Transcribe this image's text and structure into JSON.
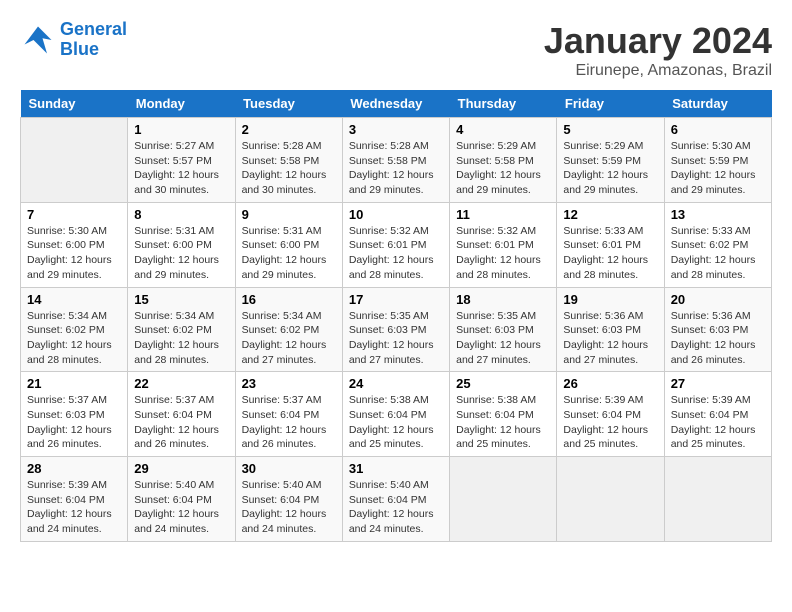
{
  "logo": {
    "line1": "General",
    "line2": "Blue"
  },
  "title": "January 2024",
  "location": "Eirunepe, Amazonas, Brazil",
  "days_header": [
    "Sunday",
    "Monday",
    "Tuesday",
    "Wednesday",
    "Thursday",
    "Friday",
    "Saturday"
  ],
  "weeks": [
    [
      {
        "day": "",
        "info": ""
      },
      {
        "day": "1",
        "info": "Sunrise: 5:27 AM\nSunset: 5:57 PM\nDaylight: 12 hours\nand 30 minutes."
      },
      {
        "day": "2",
        "info": "Sunrise: 5:28 AM\nSunset: 5:58 PM\nDaylight: 12 hours\nand 30 minutes."
      },
      {
        "day": "3",
        "info": "Sunrise: 5:28 AM\nSunset: 5:58 PM\nDaylight: 12 hours\nand 29 minutes."
      },
      {
        "day": "4",
        "info": "Sunrise: 5:29 AM\nSunset: 5:58 PM\nDaylight: 12 hours\nand 29 minutes."
      },
      {
        "day": "5",
        "info": "Sunrise: 5:29 AM\nSunset: 5:59 PM\nDaylight: 12 hours\nand 29 minutes."
      },
      {
        "day": "6",
        "info": "Sunrise: 5:30 AM\nSunset: 5:59 PM\nDaylight: 12 hours\nand 29 minutes."
      }
    ],
    [
      {
        "day": "7",
        "info": "Sunrise: 5:30 AM\nSunset: 6:00 PM\nDaylight: 12 hours\nand 29 minutes."
      },
      {
        "day": "8",
        "info": "Sunrise: 5:31 AM\nSunset: 6:00 PM\nDaylight: 12 hours\nand 29 minutes."
      },
      {
        "day": "9",
        "info": "Sunrise: 5:31 AM\nSunset: 6:00 PM\nDaylight: 12 hours\nand 29 minutes."
      },
      {
        "day": "10",
        "info": "Sunrise: 5:32 AM\nSunset: 6:01 PM\nDaylight: 12 hours\nand 28 minutes."
      },
      {
        "day": "11",
        "info": "Sunrise: 5:32 AM\nSunset: 6:01 PM\nDaylight: 12 hours\nand 28 minutes."
      },
      {
        "day": "12",
        "info": "Sunrise: 5:33 AM\nSunset: 6:01 PM\nDaylight: 12 hours\nand 28 minutes."
      },
      {
        "day": "13",
        "info": "Sunrise: 5:33 AM\nSunset: 6:02 PM\nDaylight: 12 hours\nand 28 minutes."
      }
    ],
    [
      {
        "day": "14",
        "info": "Sunrise: 5:34 AM\nSunset: 6:02 PM\nDaylight: 12 hours\nand 28 minutes."
      },
      {
        "day": "15",
        "info": "Sunrise: 5:34 AM\nSunset: 6:02 PM\nDaylight: 12 hours\nand 28 minutes."
      },
      {
        "day": "16",
        "info": "Sunrise: 5:34 AM\nSunset: 6:02 PM\nDaylight: 12 hours\nand 27 minutes."
      },
      {
        "day": "17",
        "info": "Sunrise: 5:35 AM\nSunset: 6:03 PM\nDaylight: 12 hours\nand 27 minutes."
      },
      {
        "day": "18",
        "info": "Sunrise: 5:35 AM\nSunset: 6:03 PM\nDaylight: 12 hours\nand 27 minutes."
      },
      {
        "day": "19",
        "info": "Sunrise: 5:36 AM\nSunset: 6:03 PM\nDaylight: 12 hours\nand 27 minutes."
      },
      {
        "day": "20",
        "info": "Sunrise: 5:36 AM\nSunset: 6:03 PM\nDaylight: 12 hours\nand 26 minutes."
      }
    ],
    [
      {
        "day": "21",
        "info": "Sunrise: 5:37 AM\nSunset: 6:03 PM\nDaylight: 12 hours\nand 26 minutes."
      },
      {
        "day": "22",
        "info": "Sunrise: 5:37 AM\nSunset: 6:04 PM\nDaylight: 12 hours\nand 26 minutes."
      },
      {
        "day": "23",
        "info": "Sunrise: 5:37 AM\nSunset: 6:04 PM\nDaylight: 12 hours\nand 26 minutes."
      },
      {
        "day": "24",
        "info": "Sunrise: 5:38 AM\nSunset: 6:04 PM\nDaylight: 12 hours\nand 25 minutes."
      },
      {
        "day": "25",
        "info": "Sunrise: 5:38 AM\nSunset: 6:04 PM\nDaylight: 12 hours\nand 25 minutes."
      },
      {
        "day": "26",
        "info": "Sunrise: 5:39 AM\nSunset: 6:04 PM\nDaylight: 12 hours\nand 25 minutes."
      },
      {
        "day": "27",
        "info": "Sunrise: 5:39 AM\nSunset: 6:04 PM\nDaylight: 12 hours\nand 25 minutes."
      }
    ],
    [
      {
        "day": "28",
        "info": "Sunrise: 5:39 AM\nSunset: 6:04 PM\nDaylight: 12 hours\nand 24 minutes."
      },
      {
        "day": "29",
        "info": "Sunrise: 5:40 AM\nSunset: 6:04 PM\nDaylight: 12 hours\nand 24 minutes."
      },
      {
        "day": "30",
        "info": "Sunrise: 5:40 AM\nSunset: 6:04 PM\nDaylight: 12 hours\nand 24 minutes."
      },
      {
        "day": "31",
        "info": "Sunrise: 5:40 AM\nSunset: 6:04 PM\nDaylight: 12 hours\nand 24 minutes."
      },
      {
        "day": "",
        "info": ""
      },
      {
        "day": "",
        "info": ""
      },
      {
        "day": "",
        "info": ""
      }
    ]
  ]
}
